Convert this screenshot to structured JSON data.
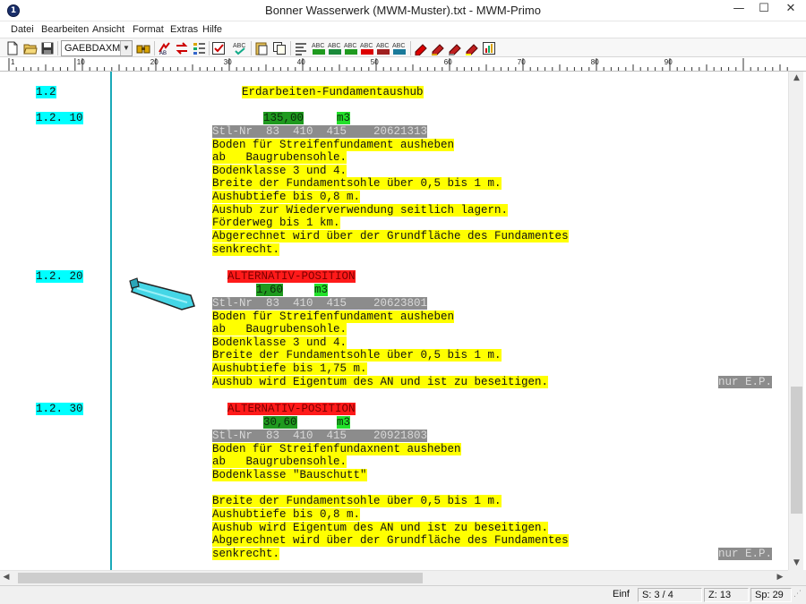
{
  "window": {
    "title": "Bonner Wasserwerk (MWM-Muster).txt - MWM-Primo",
    "icon": "app-icon",
    "controls": {
      "minimize": "—",
      "maximize": "☐",
      "close": "✕"
    }
  },
  "menu": [
    "Datei",
    "Bearbeiten",
    "Ansicht",
    "Format",
    "Extras",
    "Hilfe"
  ],
  "toolbar": {
    "format_select": "GAEBDAXML",
    "icons": [
      "new-file-icon",
      "open-folder-icon",
      "save-icon",
      "export-icon",
      "binoculars-icon",
      "transfer-icon",
      "exchange-icon",
      "list-icon",
      "checklist-icon",
      "spellcheck-icon",
      "paste-icon",
      "copy-icon",
      "format-icon",
      "abc-green-icon",
      "abc-blue-icon",
      "abc-red-icon",
      "abc-icon",
      "abc-dark-icon",
      "highlighter-red-icon",
      "highlighter-red2-icon",
      "highlighter-gray-icon",
      "highlighter-yellow-icon",
      "chart-icon"
    ]
  },
  "ruler": {
    "labels": [
      "1",
      "10",
      "20",
      "30",
      "40",
      "50",
      "60",
      "70",
      "80",
      "90"
    ]
  },
  "document": {
    "section": {
      "number": "1.2",
      "title": "Erdarbeiten-Fundamentaushub"
    },
    "positions": [
      {
        "number": "1.2. 10",
        "quantity": "135,00",
        "unit": "m3",
        "stl": "Stl-Nr  83  410  415    20621313",
        "text": [
          "Boden für Streifenfundament ausheben",
          "ab   Baugrubensohle.",
          "Bodenklasse 3 und 4.",
          "Breite der Fundamentsohle über 0,5 bis 1 m.",
          "Aushubtiefe bis 0,8 m.",
          "Aushub zur Wiederverwendung seitlich lagern.",
          "Förderweg bis 1 km.",
          "Abgerechnet wird über der Grundfläche des Fundamentes",
          "senkrecht."
        ]
      },
      {
        "number": "1.2. 20",
        "alt": "ALTERNATIV-POSITION",
        "quantity": "1,60",
        "unit": "m3",
        "stl": "Stl-Nr  83  410  415    20623801",
        "text": [
          "Boden für Streifenfundament ausheben",
          "ab   Baugrubensohle.",
          "Bodenklasse 3 und 4.",
          "Breite der Fundamentsohle über 0,5 bis 1 m.",
          "Aushubtiefe bis 1,75 m.",
          "Aushub wird Eigentum des AN und ist zu beseitigen."
        ],
        "note": "nur E.P."
      },
      {
        "number": "1.2. 30",
        "alt": "ALTERNATIV-POSITION",
        "quantity": "30,60",
        "unit": "m3",
        "stl": "Stl-Nr  83  410  415    20921803",
        "text": [
          "Boden für Streifenfundaxnent ausheben",
          "ab   Baugrubensohle.",
          "Bodenklasse \"Bauschutt\"",
          "",
          "Breite der Fundamentsohle über 0,5 bis 1 m.",
          "Aushubtiefe bis 0,8 m.",
          "Aushub wird Eigentum des AN und ist zu beseitigen.",
          "Abgerechnet wird über der Grundfläche des Fundamentes",
          "senkrecht."
        ],
        "note": "nur E.P."
      }
    ]
  },
  "status": {
    "mode": "Einf",
    "page": "S: 3 / 4",
    "line": "Z: 13",
    "column": "Sp: 29"
  },
  "colors": {
    "highlight_yellow": "#ffff00",
    "position_cyan": "#00ffff",
    "stl_gray": "#8c8c8c",
    "quantity_green": "#1f9a1f",
    "unit_green": "#22e02a",
    "alternative_red": "#ff1a1a",
    "margin_line": "#1aa9b8"
  }
}
